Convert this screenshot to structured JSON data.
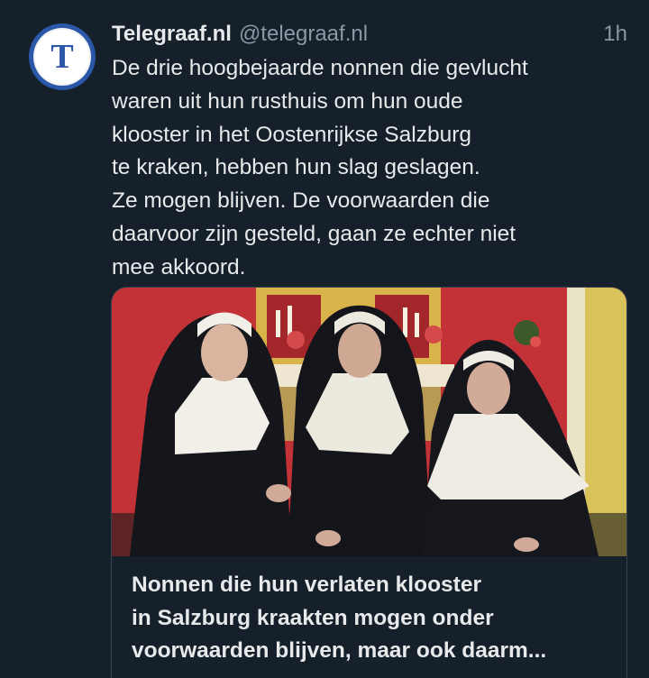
{
  "tweet": {
    "display_name": "Telegraaf.nl",
    "handle": "@telegraaf.nl",
    "time": "1h",
    "text": "De drie hoogbejaarde nonnen die gevlucht\nwaren uit hun rusthuis om hun oude\nklooster in het Oostenrijkse Salzburg\nte kraken, hebben hun slag geslagen.\nZe mogen blijven. De voorwaarden die\ndaarvoor zijn gesteld, gaan ze echter niet\nmee akkoord.",
    "avatar_icon": "telegraaf-logo-icon"
  },
  "card": {
    "image_icon": "nuns-photo",
    "title": "Nonnen die hun verlaten klooster\nin Salzburg kraakten mogen onder\nvoorwaarden blijven, maar ook daarm..."
  },
  "colors": {
    "background": "#15202b",
    "text_primary": "#e7e9ea",
    "text_secondary": "#8b98a5",
    "border": "#38444d",
    "avatar_blue": "#2b57a8"
  }
}
